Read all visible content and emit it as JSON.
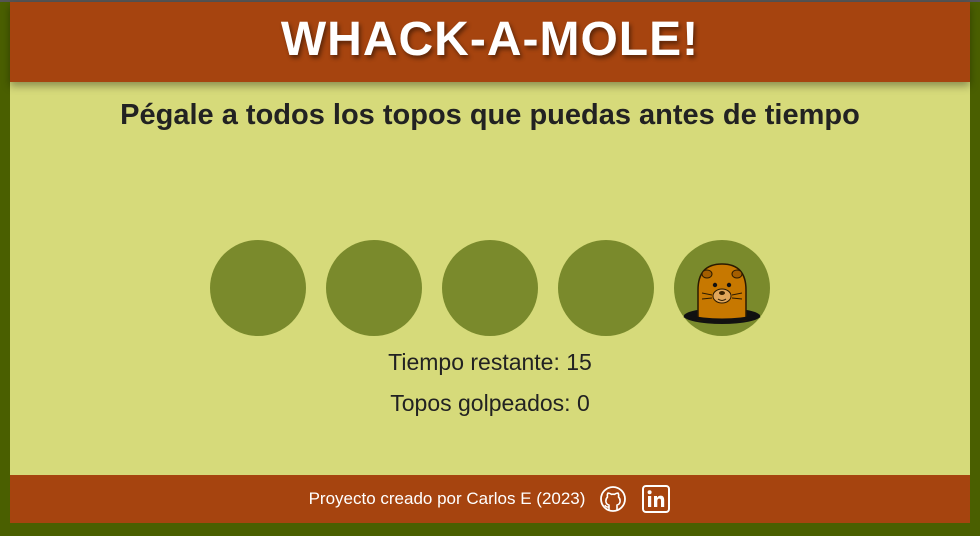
{
  "header": {
    "title": "WHACK-A-MOLE!"
  },
  "instructions": "Pégale a todos los topos que puedas antes de tiempo",
  "board": {
    "holes": [
      false,
      false,
      false,
      false,
      true
    ]
  },
  "stats": {
    "time_text": "Tiempo restante: 15",
    "score_text": "Topos golpeados: 0"
  },
  "footer": {
    "credit": "Proyecto creado por Carlos E (2023)",
    "links": [
      {
        "icon": "github-icon"
      },
      {
        "icon": "linkedin-icon"
      }
    ]
  },
  "colors": {
    "header_bg": "#a6440f",
    "page_bg": "#d6da7a",
    "outer_bg": "#4a5f00",
    "hole": "#7a8a2c",
    "mole": "#c77800"
  }
}
